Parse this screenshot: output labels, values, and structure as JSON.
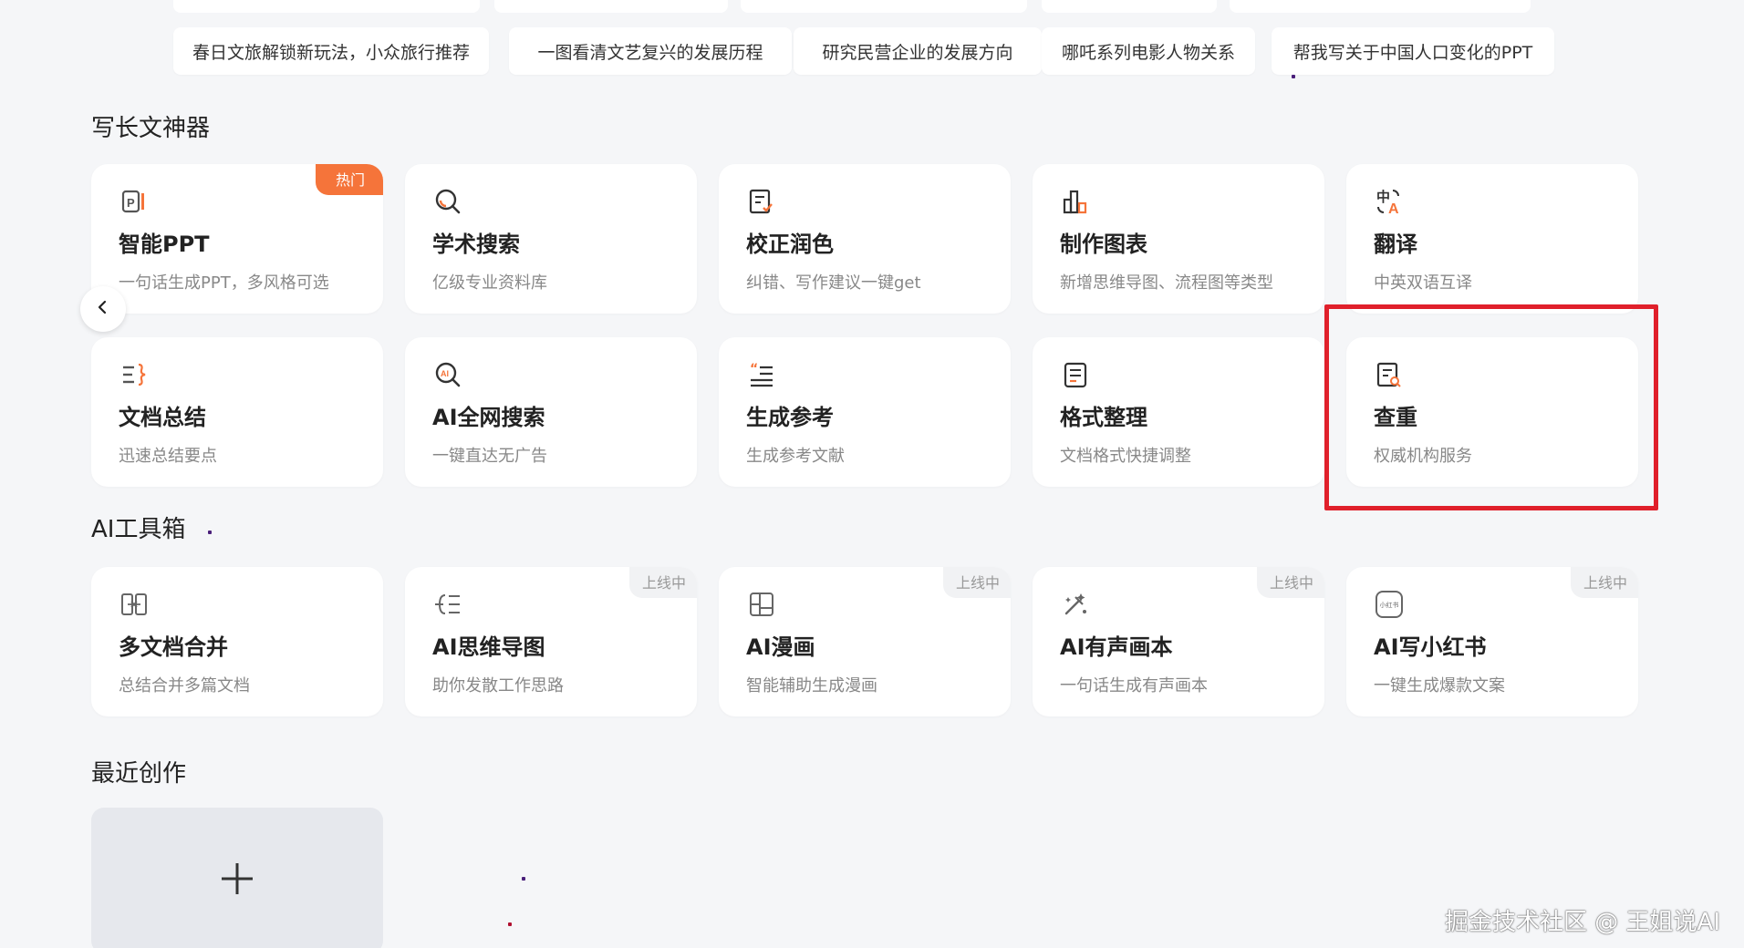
{
  "chips": [
    "春日文旅解锁新玩法，小众旅行推荐",
    "一图看清文艺复兴的发展历程",
    "研究民营企业的发展方向",
    "哪吒系列电影人物关系",
    "帮我写关于中国人口变化的PPT"
  ],
  "sections": {
    "writing": "写长文神器",
    "toolbox": "AI工具箱",
    "recent": "最近创作"
  },
  "writing_cards": [
    {
      "title": "智能PPT",
      "desc": "一句话生成PPT，多风格可选",
      "badge": "热门",
      "icon": "ppt-icon"
    },
    {
      "title": "学术搜索",
      "desc": "亿级专业资料库",
      "icon": "search-icon"
    },
    {
      "title": "校正润色",
      "desc": "纠错、写作建议一键get",
      "icon": "edit-check-icon"
    },
    {
      "title": "制作图表",
      "desc": "新增思维导图、流程图等类型",
      "icon": "chart-icon"
    },
    {
      "title": "翻译",
      "desc": "中英双语互译",
      "icon": "translate-icon"
    },
    {
      "title": "文档总结",
      "desc": "迅速总结要点",
      "icon": "summary-icon"
    },
    {
      "title": "AI全网搜索",
      "desc": "一键直达无广告",
      "icon": "ai-search-icon"
    },
    {
      "title": "生成参考",
      "desc": "生成参考文献",
      "icon": "quote-list-icon"
    },
    {
      "title": "格式整理",
      "desc": "文档格式快捷调整",
      "icon": "format-doc-icon"
    },
    {
      "title": "查重",
      "desc": "权威机构服务",
      "icon": "doc-check-icon"
    }
  ],
  "toolbox_cards": [
    {
      "title": "多文档合并",
      "desc": "总结合并多篇文档",
      "icon": "merge-icon"
    },
    {
      "title": "AI思维导图",
      "desc": "助你发散工作思路",
      "badge": "上线中",
      "icon": "mindmap-icon"
    },
    {
      "title": "AI漫画",
      "desc": "智能辅助生成漫画",
      "badge": "上线中",
      "icon": "comic-icon"
    },
    {
      "title": "AI有声画本",
      "desc": "一句话生成有声画本",
      "badge": "上线中",
      "icon": "audio-book-icon"
    },
    {
      "title": "AI写小红书",
      "desc": "一键生成爆款文案",
      "badge": "上线中",
      "icon": "xiaohongshu-icon",
      "icon_text": "小红书"
    }
  ],
  "new_creation_icon": "plus-icon",
  "watermark": "掘金技术社区 @ 王姐说AI",
  "colors": {
    "accent": "#f5743a",
    "highlight": "#e0202b",
    "background": "#f5f6f8"
  }
}
